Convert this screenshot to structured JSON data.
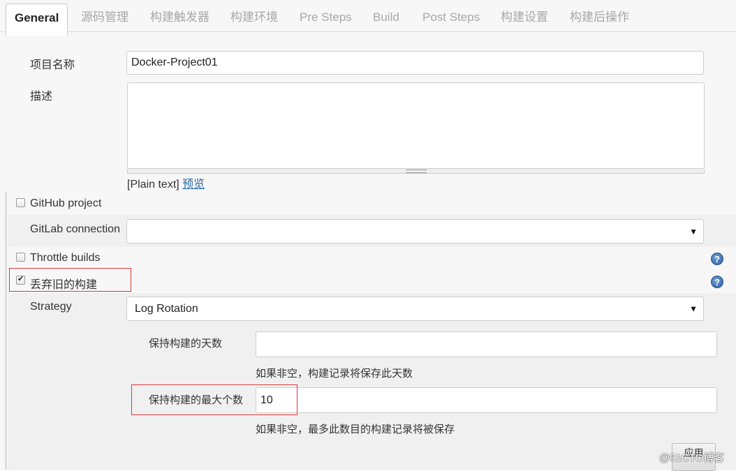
{
  "tabs": [
    "General",
    "源码管理",
    "构建触发器",
    "构建环境",
    "Pre Steps",
    "Build",
    "Post Steps",
    "构建设置",
    "构建后操作"
  ],
  "project_name": {
    "label": "项目名称",
    "value": "Docker-Project01"
  },
  "description": {
    "label": "描述",
    "value": "",
    "format_text": "[Plain text]",
    "preview_link": "预览"
  },
  "github_project": {
    "label": "GitHub project",
    "checked": false
  },
  "gitlab_connection": {
    "label": "GitLab connection",
    "value": ""
  },
  "throttle_builds": {
    "label": "Throttle builds",
    "checked": false
  },
  "discard_old_builds": {
    "label": "丢弃旧的构建",
    "checked": true
  },
  "strategy": {
    "label": "Strategy",
    "value": "Log Rotation"
  },
  "days_to_keep": {
    "label": "保持构建的天数",
    "value": "",
    "hint": "如果非空，构建记录将保存此天数"
  },
  "max_builds": {
    "label": "保持构建的最大个数",
    "value": "10",
    "hint": "如果非空，最多此数目的构建记录将被保存"
  },
  "apply_button": "应用",
  "watermark": "@51CTO博客",
  "colors": {
    "highlight_box": "#d9373a",
    "link": "#2a6aad",
    "help_icon": "#2c5f9e"
  }
}
